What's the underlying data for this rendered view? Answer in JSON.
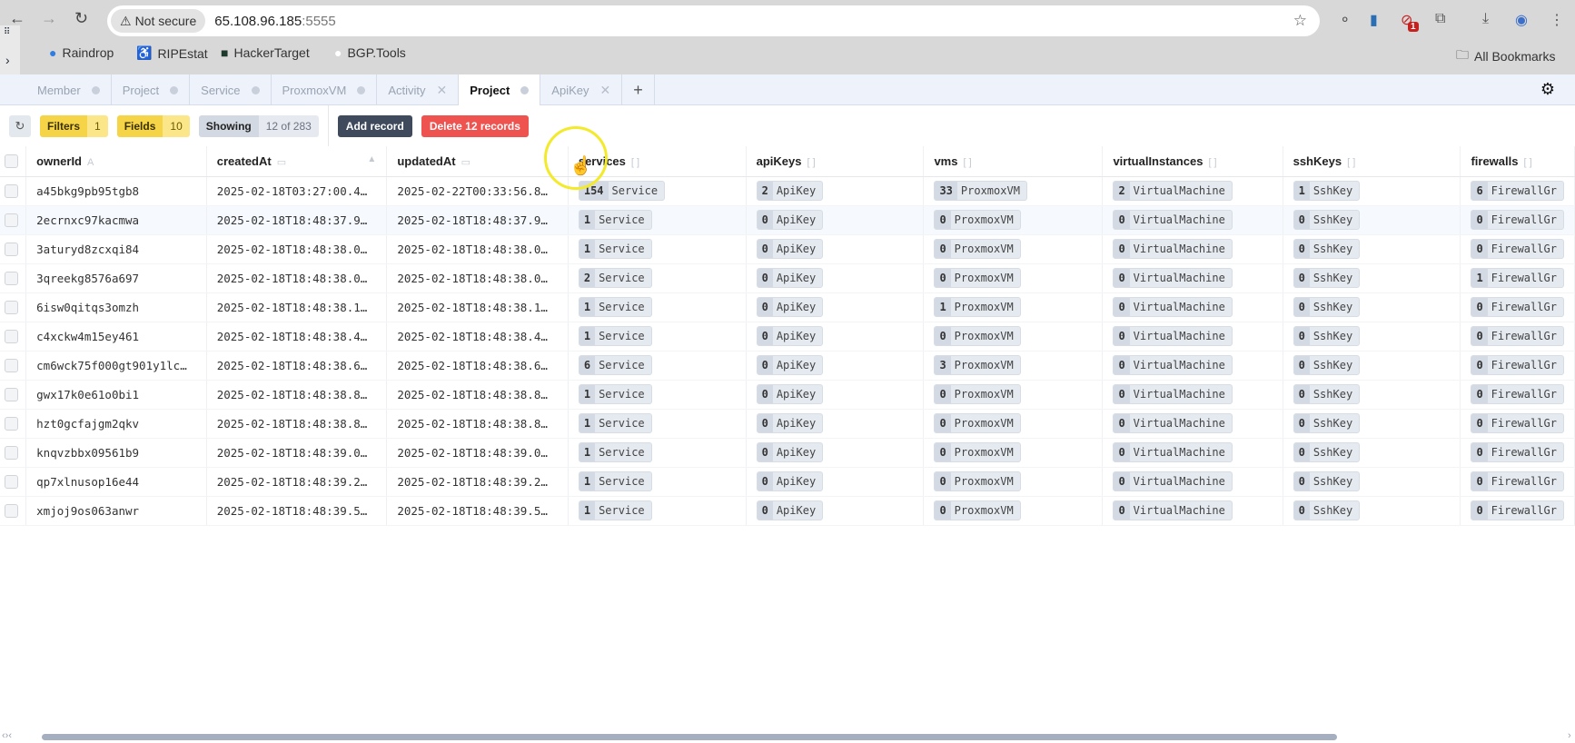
{
  "browser": {
    "not_secure": "Not secure",
    "url_host": "65.108.96.185",
    "url_port": ":5555",
    "notification_count": "1",
    "bookmarks": [
      "Raindrop",
      "RIPEstat",
      "HackerTarget",
      "BGP.Tools"
    ],
    "all_bookmarks": "All Bookmarks"
  },
  "tabs": [
    {
      "label": "Member",
      "icon": "dot"
    },
    {
      "label": "Project",
      "icon": "dot"
    },
    {
      "label": "Service",
      "icon": "dot"
    },
    {
      "label": "ProxmoxVM",
      "icon": "dot"
    },
    {
      "label": "Activity",
      "icon": "close"
    },
    {
      "label": "Project",
      "icon": "dot",
      "active": true
    },
    {
      "label": "ApiKey",
      "icon": "close"
    }
  ],
  "toolbar": {
    "filters_label": "Filters",
    "filters_count": "1",
    "fields_label": "Fields",
    "fields_count": "10",
    "showing_label": "Showing",
    "showing_value": "12 of 283",
    "add_record": "Add record",
    "delete_records": "Delete 12 records"
  },
  "columns": [
    {
      "name": "ownerId",
      "type": "A"
    },
    {
      "name": "createdAt",
      "type": "▭"
    },
    {
      "name": "updatedAt",
      "type": "▭"
    },
    {
      "name": "services",
      "type": "[ ]"
    },
    {
      "name": "apiKeys",
      "type": "[ ]"
    },
    {
      "name": "vms",
      "type": "[ ]"
    },
    {
      "name": "virtualInstances",
      "type": "[ ]"
    },
    {
      "name": "sshKeys",
      "type": "[ ]"
    },
    {
      "name": "firewalls",
      "type": "[ ]"
    }
  ],
  "relation_labels": [
    "Service",
    "ApiKey",
    "ProxmoxVM",
    "VirtualMachine",
    "SshKey",
    "FirewallGr"
  ],
  "rows": [
    {
      "ownerId": "a45bkg9pb95tgb8",
      "createdAt": "2025-02-18T03:27:00.4…",
      "updatedAt": "2025-02-22T00:33:56.8…",
      "counts": [
        "154",
        "2",
        "33",
        "2",
        "1",
        "6"
      ]
    },
    {
      "ownerId": "2ecrnxc97kacmwa",
      "createdAt": "2025-02-18T18:48:37.9…",
      "updatedAt": "2025-02-18T18:48:37.9…",
      "counts": [
        "1",
        "0",
        "0",
        "0",
        "0",
        "0"
      ]
    },
    {
      "ownerId": "3aturyd8zcxqi84",
      "createdAt": "2025-02-18T18:48:38.0…",
      "updatedAt": "2025-02-18T18:48:38.0…",
      "counts": [
        "1",
        "0",
        "0",
        "0",
        "0",
        "0"
      ]
    },
    {
      "ownerId": "3qreekg8576a697",
      "createdAt": "2025-02-18T18:48:38.0…",
      "updatedAt": "2025-02-18T18:48:38.0…",
      "counts": [
        "2",
        "0",
        "0",
        "0",
        "0",
        "1"
      ]
    },
    {
      "ownerId": "6isw0qitqs3omzh",
      "createdAt": "2025-02-18T18:48:38.1…",
      "updatedAt": "2025-02-18T18:48:38.1…",
      "counts": [
        "1",
        "0",
        "1",
        "0",
        "0",
        "0"
      ]
    },
    {
      "ownerId": "c4xckw4m15ey461",
      "createdAt": "2025-02-18T18:48:38.4…",
      "updatedAt": "2025-02-18T18:48:38.4…",
      "counts": [
        "1",
        "0",
        "0",
        "0",
        "0",
        "0"
      ]
    },
    {
      "ownerId": "cm6wck75f000gt901y1lc…",
      "createdAt": "2025-02-18T18:48:38.6…",
      "updatedAt": "2025-02-18T18:48:38.6…",
      "counts": [
        "6",
        "0",
        "3",
        "0",
        "0",
        "0"
      ]
    },
    {
      "ownerId": "gwx17k0e61o0bi1",
      "createdAt": "2025-02-18T18:48:38.8…",
      "updatedAt": "2025-02-18T18:48:38.8…",
      "counts": [
        "1",
        "0",
        "0",
        "0",
        "0",
        "0"
      ]
    },
    {
      "ownerId": "hzt0gcfajgm2qkv",
      "createdAt": "2025-02-18T18:48:38.8…",
      "updatedAt": "2025-02-18T18:48:38.8…",
      "counts": [
        "1",
        "0",
        "0",
        "0",
        "0",
        "0"
      ]
    },
    {
      "ownerId": "knqvzbbx09561b9",
      "createdAt": "2025-02-18T18:48:39.0…",
      "updatedAt": "2025-02-18T18:48:39.0…",
      "counts": [
        "1",
        "0",
        "0",
        "0",
        "0",
        "0"
      ]
    },
    {
      "ownerId": "qp7xlnusop16e44",
      "createdAt": "2025-02-18T18:48:39.2…",
      "updatedAt": "2025-02-18T18:48:39.2…",
      "counts": [
        "1",
        "0",
        "0",
        "0",
        "0",
        "0"
      ]
    },
    {
      "ownerId": "xmjoj9os063anwr",
      "createdAt": "2025-02-18T18:48:39.5…",
      "updatedAt": "2025-02-18T18:48:39.5…",
      "counts": [
        "1",
        "0",
        "0",
        "0",
        "0",
        "0"
      ]
    }
  ]
}
